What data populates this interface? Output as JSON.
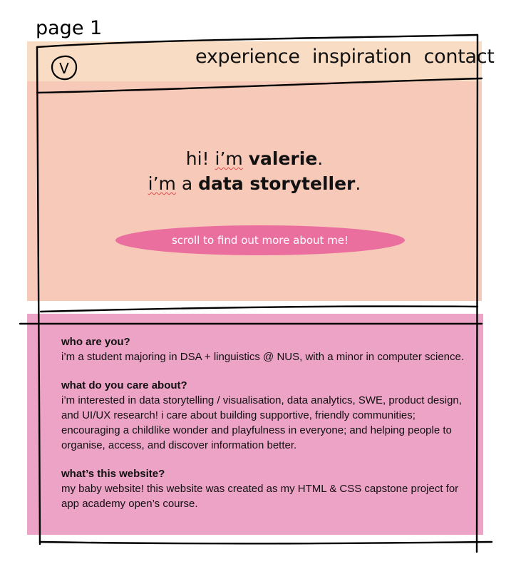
{
  "page_label": "page 1",
  "header": {
    "logo_letter": "V",
    "nav": [
      "experience",
      "inspiration",
      "contact"
    ]
  },
  "hero": {
    "line1_pre": "hi! ",
    "line1_im": "i’m",
    "line1_name": "valerie",
    "line1_end": ".",
    "line2_im": "i’m",
    "line2_a": " a ",
    "line2_role": "data storyteller",
    "line2_end": ".",
    "cta": "scroll to find out more about me!"
  },
  "about": [
    {
      "question": "who are you?",
      "answer": "i’m a student majoring in DSA + linguistics @ NUS, with a minor in computer science."
    },
    {
      "question": "what do you care about?",
      "answer": "i’m interested in data storytelling / visualisation, data analytics, SWE, product design, and UI/UX research! i care about building supportive, friendly communities; encouraging a childlike wonder and playfulness in everyone; and helping people to organise, access, and discover information better."
    },
    {
      "question": "what’s this website?",
      "answer": "my baby website! this website was created as my HTML & CSS capstone project for app academy open’s course."
    }
  ],
  "colors": {
    "header_bg": "#f9dcc4",
    "hero_bg": "#f6c9b9",
    "about_bg": "#eda3c6",
    "cta_bg": "#ea6f9e",
    "spellcheck": "#e04a4a"
  }
}
